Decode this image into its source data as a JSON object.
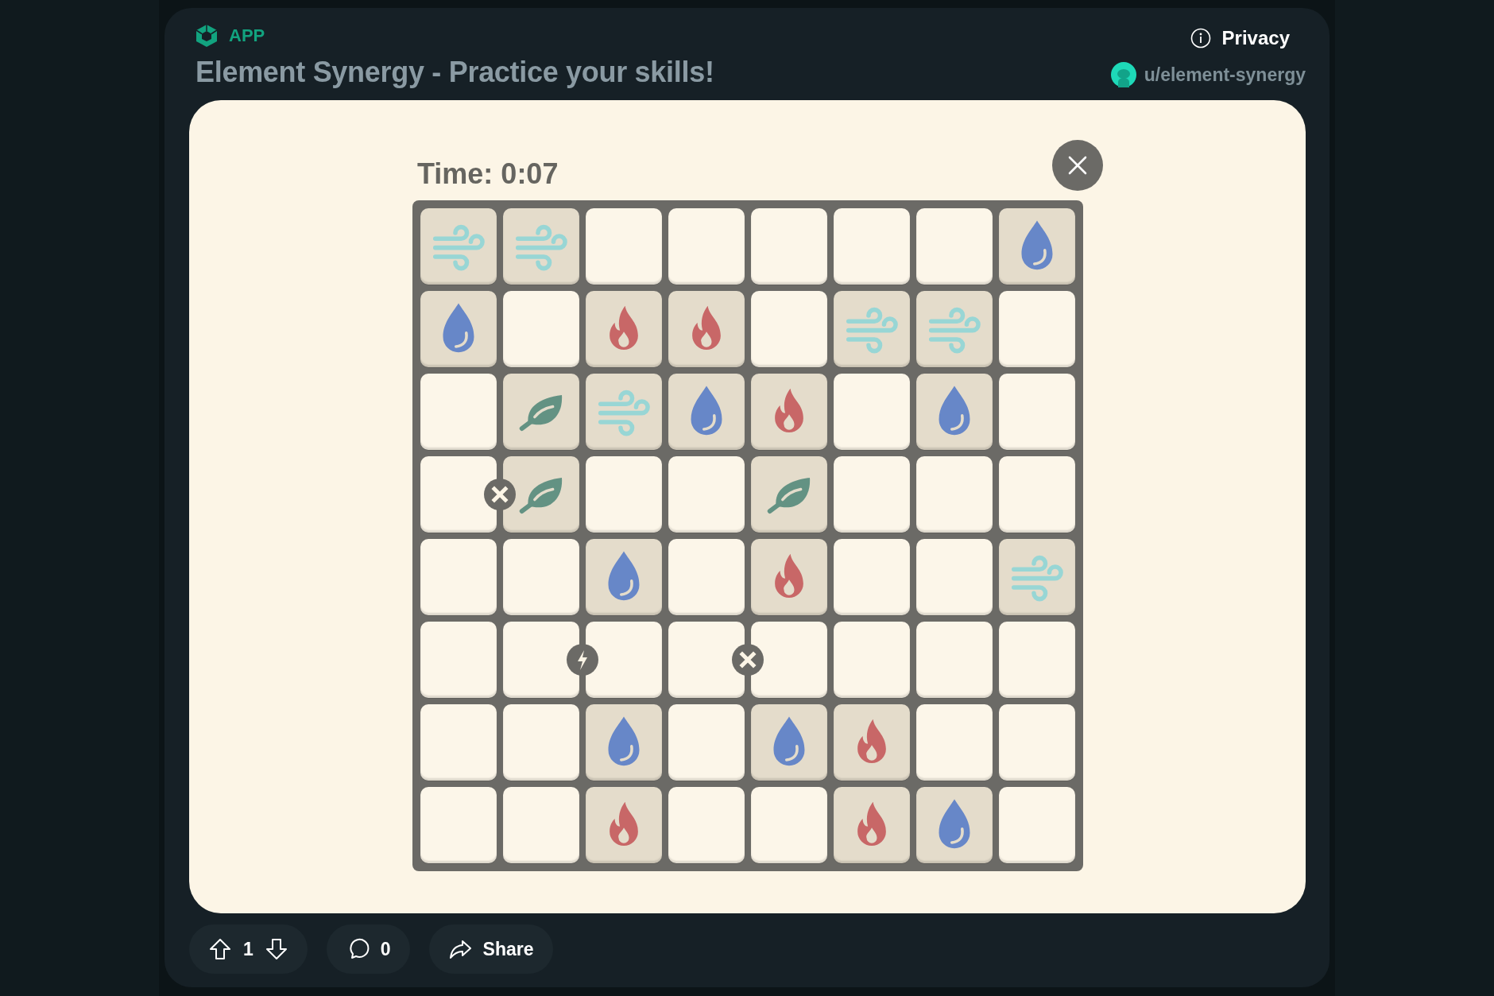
{
  "header": {
    "app_label": "APP",
    "privacy": "Privacy",
    "title": "Element Synergy - Practice your skills!",
    "username": "u/element-synergy"
  },
  "game": {
    "timer": "Time: 0:07",
    "board": [
      [
        {
          "kind": "wind"
        },
        {
          "kind": "wind"
        },
        {
          "kind": "empty"
        },
        {
          "kind": "empty"
        },
        {
          "kind": "empty"
        },
        {
          "kind": "empty"
        },
        {
          "kind": "empty"
        },
        {
          "kind": "water"
        }
      ],
      [
        {
          "kind": "water"
        },
        {
          "kind": "empty"
        },
        {
          "kind": "fire"
        },
        {
          "kind": "fire"
        },
        {
          "kind": "empty"
        },
        {
          "kind": "wind"
        },
        {
          "kind": "wind"
        },
        {
          "kind": "empty"
        }
      ],
      [
        {
          "kind": "empty"
        },
        {
          "kind": "leaf"
        },
        {
          "kind": "wind"
        },
        {
          "kind": "water"
        },
        {
          "kind": "fire"
        },
        {
          "kind": "empty"
        },
        {
          "kind": "water"
        },
        {
          "kind": "empty"
        }
      ],
      [
        {
          "kind": "empty",
          "marker": {
            "kind": "cross"
          }
        },
        {
          "kind": "leaf"
        },
        {
          "kind": "empty"
        },
        {
          "kind": "empty"
        },
        {
          "kind": "leaf"
        },
        {
          "kind": "empty"
        },
        {
          "kind": "empty"
        },
        {
          "kind": "empty"
        }
      ],
      [
        {
          "kind": "empty"
        },
        {
          "kind": "empty"
        },
        {
          "kind": "water"
        },
        {
          "kind": "empty"
        },
        {
          "kind": "fire"
        },
        {
          "kind": "empty"
        },
        {
          "kind": "empty"
        },
        {
          "kind": "wind"
        }
      ],
      [
        {
          "kind": "empty"
        },
        {
          "kind": "empty",
          "marker": {
            "kind": "bolt"
          }
        },
        {
          "kind": "empty"
        },
        {
          "kind": "empty",
          "marker": {
            "kind": "cross"
          }
        },
        {
          "kind": "empty"
        },
        {
          "kind": "empty"
        },
        {
          "kind": "empty"
        },
        {
          "kind": "empty"
        }
      ],
      [
        {
          "kind": "empty"
        },
        {
          "kind": "empty"
        },
        {
          "kind": "water"
        },
        {
          "kind": "empty"
        },
        {
          "kind": "water"
        },
        {
          "kind": "fire"
        },
        {
          "kind": "empty"
        },
        {
          "kind": "empty"
        }
      ],
      [
        {
          "kind": "empty"
        },
        {
          "kind": "empty"
        },
        {
          "kind": "fire"
        },
        {
          "kind": "empty"
        },
        {
          "kind": "empty"
        },
        {
          "kind": "fire"
        },
        {
          "kind": "water"
        },
        {
          "kind": "empty"
        }
      ]
    ]
  },
  "actions": {
    "votes": "1",
    "comments": "0",
    "share": "Share"
  }
}
